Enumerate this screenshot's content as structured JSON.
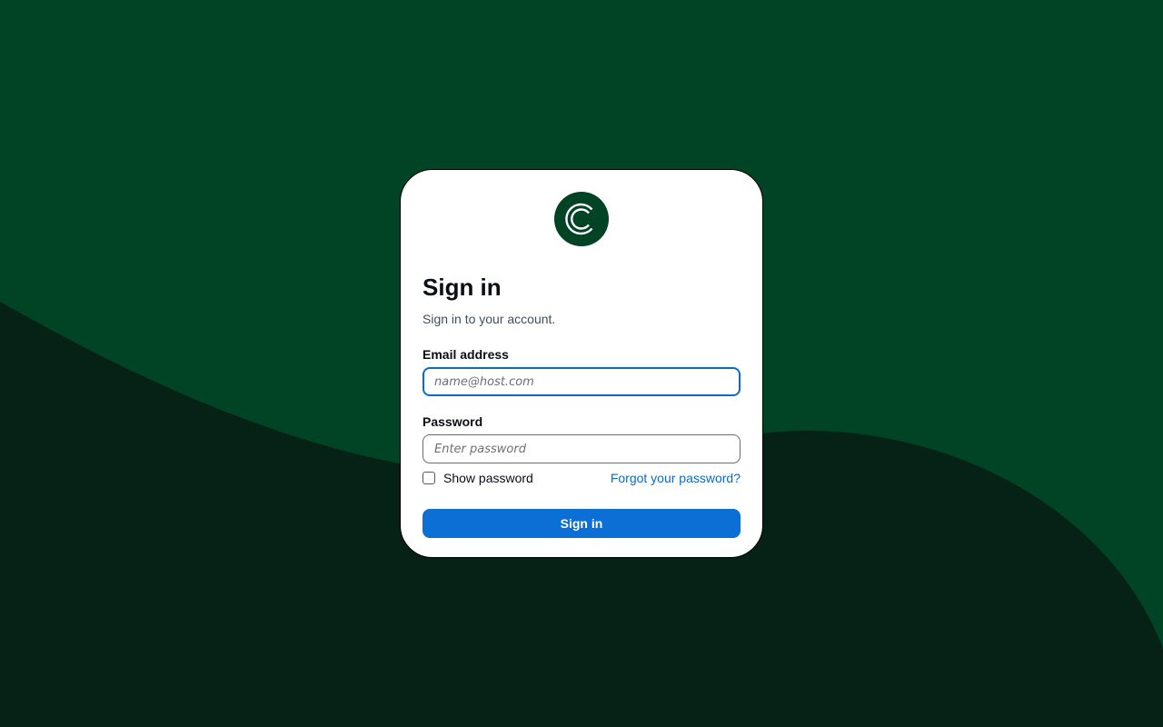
{
  "theme": {
    "background": "#014325",
    "wave": "#062216",
    "card": "#ffffff",
    "accent": "#0b6fd6",
    "logo": "#014325"
  },
  "logo": {
    "icon": "brand-c-logo-icon"
  },
  "signin": {
    "title": "Sign in",
    "subtitle": "Sign in to your account.",
    "email_label": "Email address",
    "email_placeholder": "name@host.com",
    "email_value": "",
    "password_label": "Password",
    "password_placeholder": "Enter password",
    "password_value": "",
    "show_password_label": "Show password",
    "show_password_checked": false,
    "forgot_link": "Forgot your password?",
    "submit_label": "Sign in"
  }
}
